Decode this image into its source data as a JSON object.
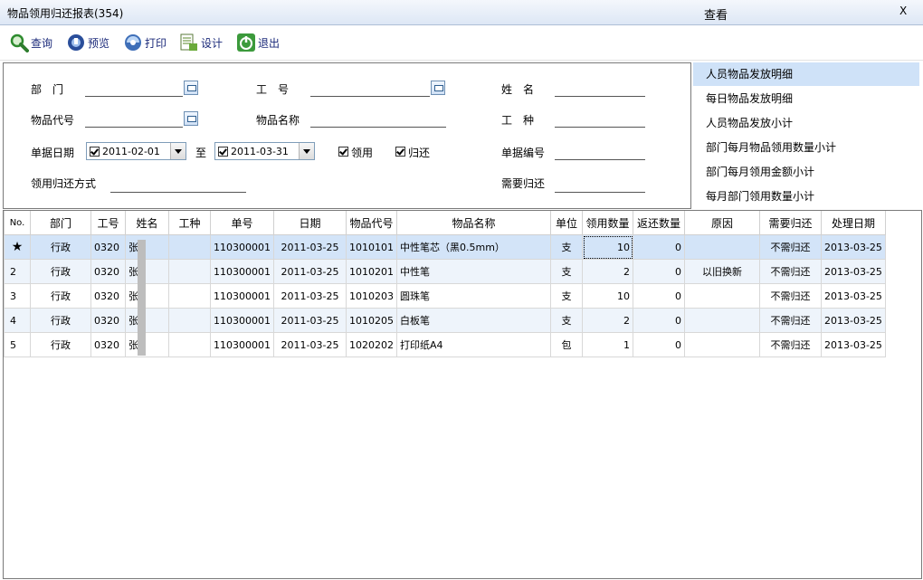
{
  "window": {
    "title": "物品领用归还报表(354)",
    "view_label": "查看",
    "close_label": "X"
  },
  "toolbar": [
    {
      "name": "query-button",
      "icon": "magnifier-icon",
      "label": "查询"
    },
    {
      "name": "preview-button",
      "icon": "preview-icon",
      "label": "预览"
    },
    {
      "name": "print-button",
      "icon": "printer-icon",
      "label": "打印"
    },
    {
      "name": "design-button",
      "icon": "design-icon",
      "label": "设计"
    },
    {
      "name": "exit-button",
      "icon": "power-icon",
      "label": "退出"
    }
  ],
  "query": {
    "dept_label": "部　门",
    "empno_label": "工　号",
    "name_label": "姓　名",
    "itemcode_label": "物品代号",
    "itemname_label": "物品名称",
    "worktype_label": "工　种",
    "date_label": "单据日期",
    "date_from": "2011-02-01",
    "to_label": "至",
    "date_to": "2011-03-31",
    "borrow_label": "领用",
    "return_label": "归还",
    "docno_label": "单据编号",
    "method_label": "领用归还方式",
    "needreturn_label": "需要归还"
  },
  "reports": [
    "人员物品发放明细",
    "每日物品发放明细",
    "人员物品发放小计",
    "部门每月物品领用数量小计",
    "部门每月领用金额小计",
    "每月部门领用数量小计"
  ],
  "grid": {
    "columns": [
      "No.",
      "部门",
      "工号",
      "姓名",
      "工种",
      "单号",
      "日期",
      "物品代号",
      "物品名称",
      "单位",
      "领用数量",
      "返还数量",
      "原因",
      "需要归还",
      "处理日期"
    ],
    "rows": [
      [
        "★",
        "行政",
        "0320",
        "张",
        "",
        "110300001",
        "2011-03-25",
        "1010101",
        "中性笔芯（黑0.5mm）",
        "支",
        "10",
        "0",
        "",
        "不需归还",
        "2013-03-25"
      ],
      [
        "2",
        "行政",
        "0320",
        "张",
        "",
        "110300001",
        "2011-03-25",
        "1010201",
        "中性笔",
        "支",
        "2",
        "0",
        "以旧换新",
        "不需归还",
        "2013-03-25"
      ],
      [
        "3",
        "行政",
        "0320",
        "张",
        "",
        "110300001",
        "2011-03-25",
        "1010203",
        "圆珠笔",
        "支",
        "10",
        "0",
        "",
        "不需归还",
        "2013-03-25"
      ],
      [
        "4",
        "行政",
        "0320",
        "张",
        "",
        "110300001",
        "2011-03-25",
        "1010205",
        "白板笔",
        "支",
        "2",
        "0",
        "",
        "不需归还",
        "2013-03-25"
      ],
      [
        "5",
        "行政",
        "0320",
        "张",
        "",
        "110300001",
        "2011-03-25",
        "1020202",
        "打印纸A4",
        "包",
        "1",
        "0",
        "",
        "不需归还",
        "2013-03-25"
      ]
    ]
  }
}
